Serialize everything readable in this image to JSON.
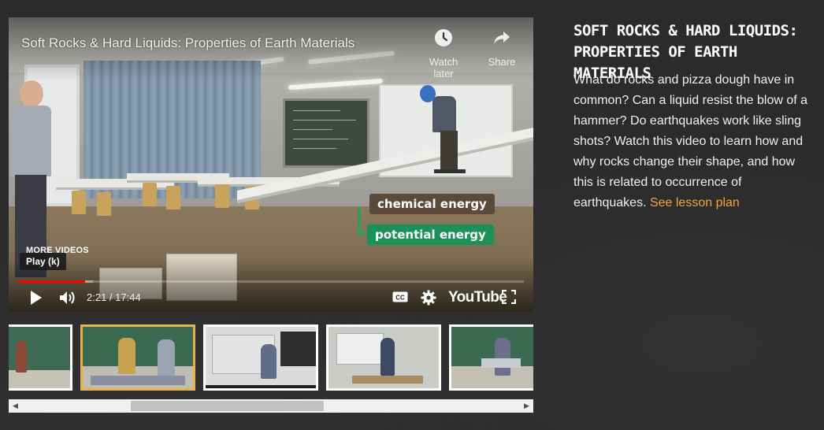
{
  "player": {
    "title": "Soft Rocks & Hard Liquids: Properties of Earth Materials",
    "watch_later_label": "Watch later",
    "share_label": "Share",
    "more_videos_label": "MORE VIDEOS",
    "play_tooltip": "Play (k)",
    "time_display": "2:21 / 17:44",
    "progress_fraction": 0.132,
    "buffer_fraction": 0.148,
    "youtube_label": "YouTube",
    "overlay_labels": {
      "top": "chemical energy",
      "bottom": "potential energy"
    },
    "icons": [
      "clock-icon",
      "share-icon",
      "play-icon",
      "volume-icon",
      "cc-icon",
      "gear-icon",
      "fullscreen-icon"
    ]
  },
  "description": {
    "title": "Soft Rocks & Hard Liquids: Properties of Earth Materials",
    "body": "What do rocks and pizza dough have in common? Can a liquid resist the blow of a hammer? Do earthquakes work like sling shots? Watch this video to learn how and why rocks change their shape, and how this is related to occurrence of earthquakes. ",
    "link_label": "See lesson plan"
  },
  "thumbnails": {
    "active_index": 1,
    "count": 5
  },
  "scrollbar": {
    "thumb_fraction_start": 0.233,
    "thumb_fraction_size": 0.368
  },
  "colors": {
    "background": "#2b2b2b",
    "accent": "#e8b14a",
    "link": "#f0a43a",
    "progress": "#ff0000",
    "potential_energy": "#1b9159",
    "chemical_energy": "#5b4a3a"
  }
}
